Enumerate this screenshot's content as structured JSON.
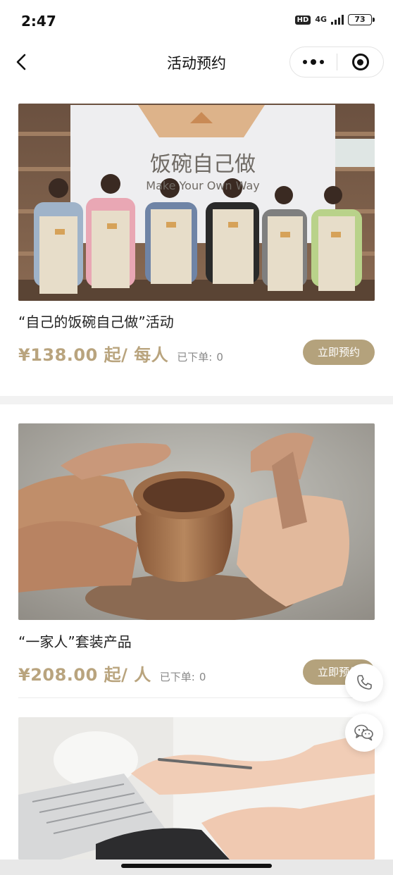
{
  "status_bar": {
    "time": "2:47",
    "hd": "HD",
    "network": "4G",
    "battery": "73"
  },
  "nav": {
    "title": "活动预约",
    "back_icon": "chevron-left-icon",
    "more_icon": "more-dots-icon",
    "close_icon": "target-close-icon"
  },
  "activities": [
    {
      "banner_text": "饭碗自己做",
      "banner_subtext": "Make Your Own Way",
      "title": "“自己的饭碗自己做”活动",
      "price": "¥138.00 起/ 每人",
      "sold_label": "已下单:",
      "sold_count": "0",
      "button": "立即预约"
    },
    {
      "title": "“一家人”套装产品",
      "price": "¥208.00 起/ 人",
      "sold_label": "已下单:",
      "sold_count": "0",
      "button": "立即预约"
    }
  ],
  "floating": {
    "phone_icon": "phone-icon",
    "chat_icon": "wechat-chat-icon"
  },
  "colors": {
    "accent": "#b4a27c",
    "price": "#b9a47e"
  }
}
